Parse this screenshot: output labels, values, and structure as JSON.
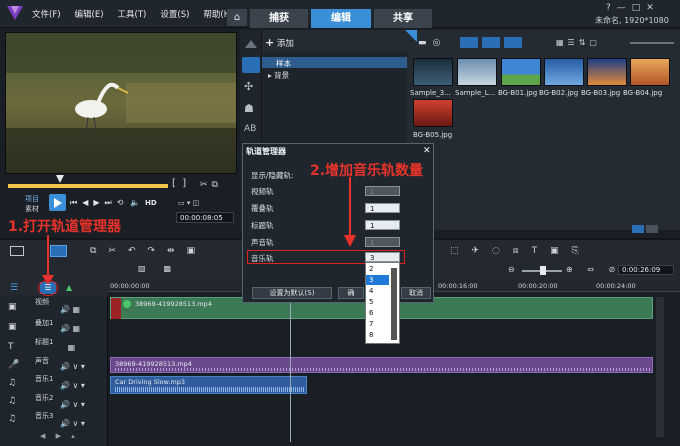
{
  "menu": [
    "文件(F)",
    "编辑(E)",
    "工具(T)",
    "设置(S)",
    "帮助(H)"
  ],
  "tabs": [
    "捕获",
    "编辑",
    "共享"
  ],
  "resolution": "未命名, 1920*1080",
  "library": {
    "add_label": "添加",
    "tree": [
      "样本",
      "背景"
    ],
    "thumbnails": [
      "Sample_3...",
      "Sample_L...",
      "BG-B01.jpg",
      "BG-B02.jpg",
      "BG-B03.jpg",
      "BG-B04.jpg",
      "BG-B05.jpg"
    ]
  },
  "player": {
    "project_label": "项目",
    "clip_label": "素材",
    "hd": "HD",
    "timecode": "00:00:08:05"
  },
  "dialog": {
    "title": "轨道管理器",
    "subtitle": "显示/隐藏轨:",
    "rows": [
      {
        "label": "视频轨",
        "value": "1",
        "disabled": true
      },
      {
        "label": "覆叠轨",
        "value": "1",
        "disabled": false
      },
      {
        "label": "标题轨",
        "value": "1",
        "disabled": false
      },
      {
        "label": "声音轨",
        "value": "1",
        "disabled": true
      },
      {
        "label": "音乐轨",
        "value": "3",
        "disabled": false
      }
    ],
    "options": [
      "2",
      "3",
      "4",
      "5",
      "6",
      "7",
      "8"
    ],
    "reset_button": "设置为默认(S)",
    "ok_button": "确",
    "cancel_button": "取消"
  },
  "annotations": {
    "step1": "1.打开轨道管理器",
    "step2": "2.增加音乐轨数量"
  },
  "timeline": {
    "timecode": "0:00:26:09",
    "ruler": [
      "00:00:00:00",
      "00:00:16:00",
      "00:00:20:00",
      "00:00:24:00"
    ],
    "tracks": [
      "视频",
      "叠加1",
      "标题1",
      "声音",
      "音乐1",
      "音乐2",
      "音乐3"
    ],
    "clips": {
      "video": "38969-419928513.mp4",
      "audio": "38969-419928513.mp4",
      "music": "Car Driving Slow.mp3"
    }
  },
  "colors": {
    "accent": "#3a8fd8",
    "annotation": "#e8332a",
    "video_clip": "#3c7a55",
    "voice_clip": "#6a4a8c",
    "music_clip": "#2f5c9c"
  }
}
